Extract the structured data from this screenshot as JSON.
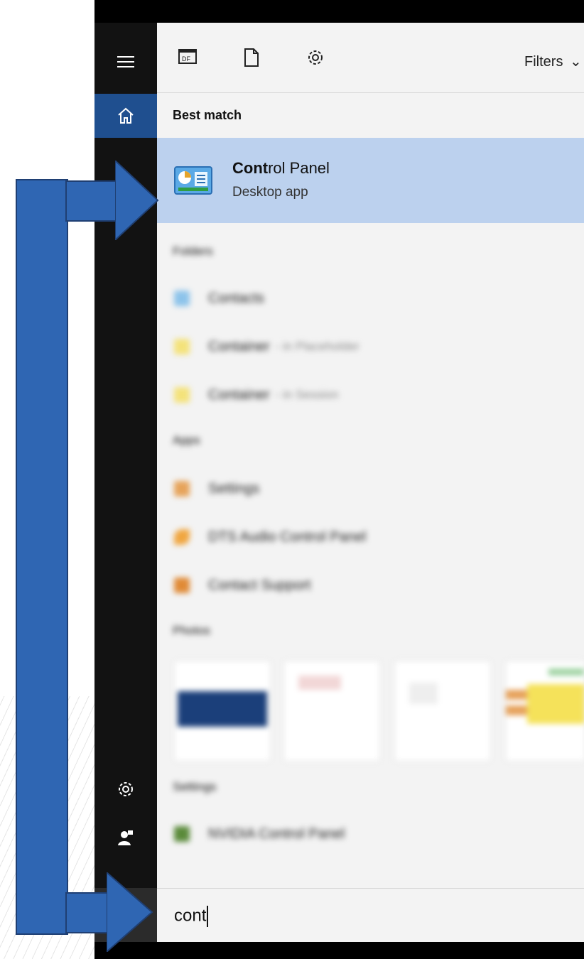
{
  "toolbar": {
    "icons": [
      "apps-icon",
      "document-icon",
      "settings-icon"
    ],
    "filters_label": "Filters"
  },
  "sidebar": {
    "items": [
      {
        "icon": "hamburger-menu-icon"
      },
      {
        "icon": "home-icon",
        "active": true
      },
      {
        "icon": "settings-icon"
      },
      {
        "icon": "user-icon"
      },
      {
        "icon": "start-icon"
      }
    ]
  },
  "results": {
    "best_match_header": "Best match",
    "best_match": {
      "title_bold": "Cont",
      "title_rest": "rol Panel",
      "subtitle": "Desktop app"
    },
    "folders_header": "Folders",
    "folders": [
      {
        "label": "Contacts",
        "muted": ""
      },
      {
        "label": "Container",
        "muted": "- in Placeholder"
      },
      {
        "label": "Container",
        "muted": "- in Session"
      }
    ],
    "apps_header": "Apps",
    "apps": [
      {
        "label": "Settings"
      },
      {
        "label": "DTS Audio Control Panel"
      },
      {
        "label": "Contact Support"
      }
    ],
    "photos_header": "Photos",
    "settings_header": "Settings",
    "settings": [
      {
        "label": "NVIDIA Control Panel"
      }
    ]
  },
  "search": {
    "value": "cont"
  },
  "colors": {
    "accent": "#2f66b3",
    "highlight": "#bcd1ee",
    "rail": "#121212",
    "home_active": "#1f4f8f"
  }
}
